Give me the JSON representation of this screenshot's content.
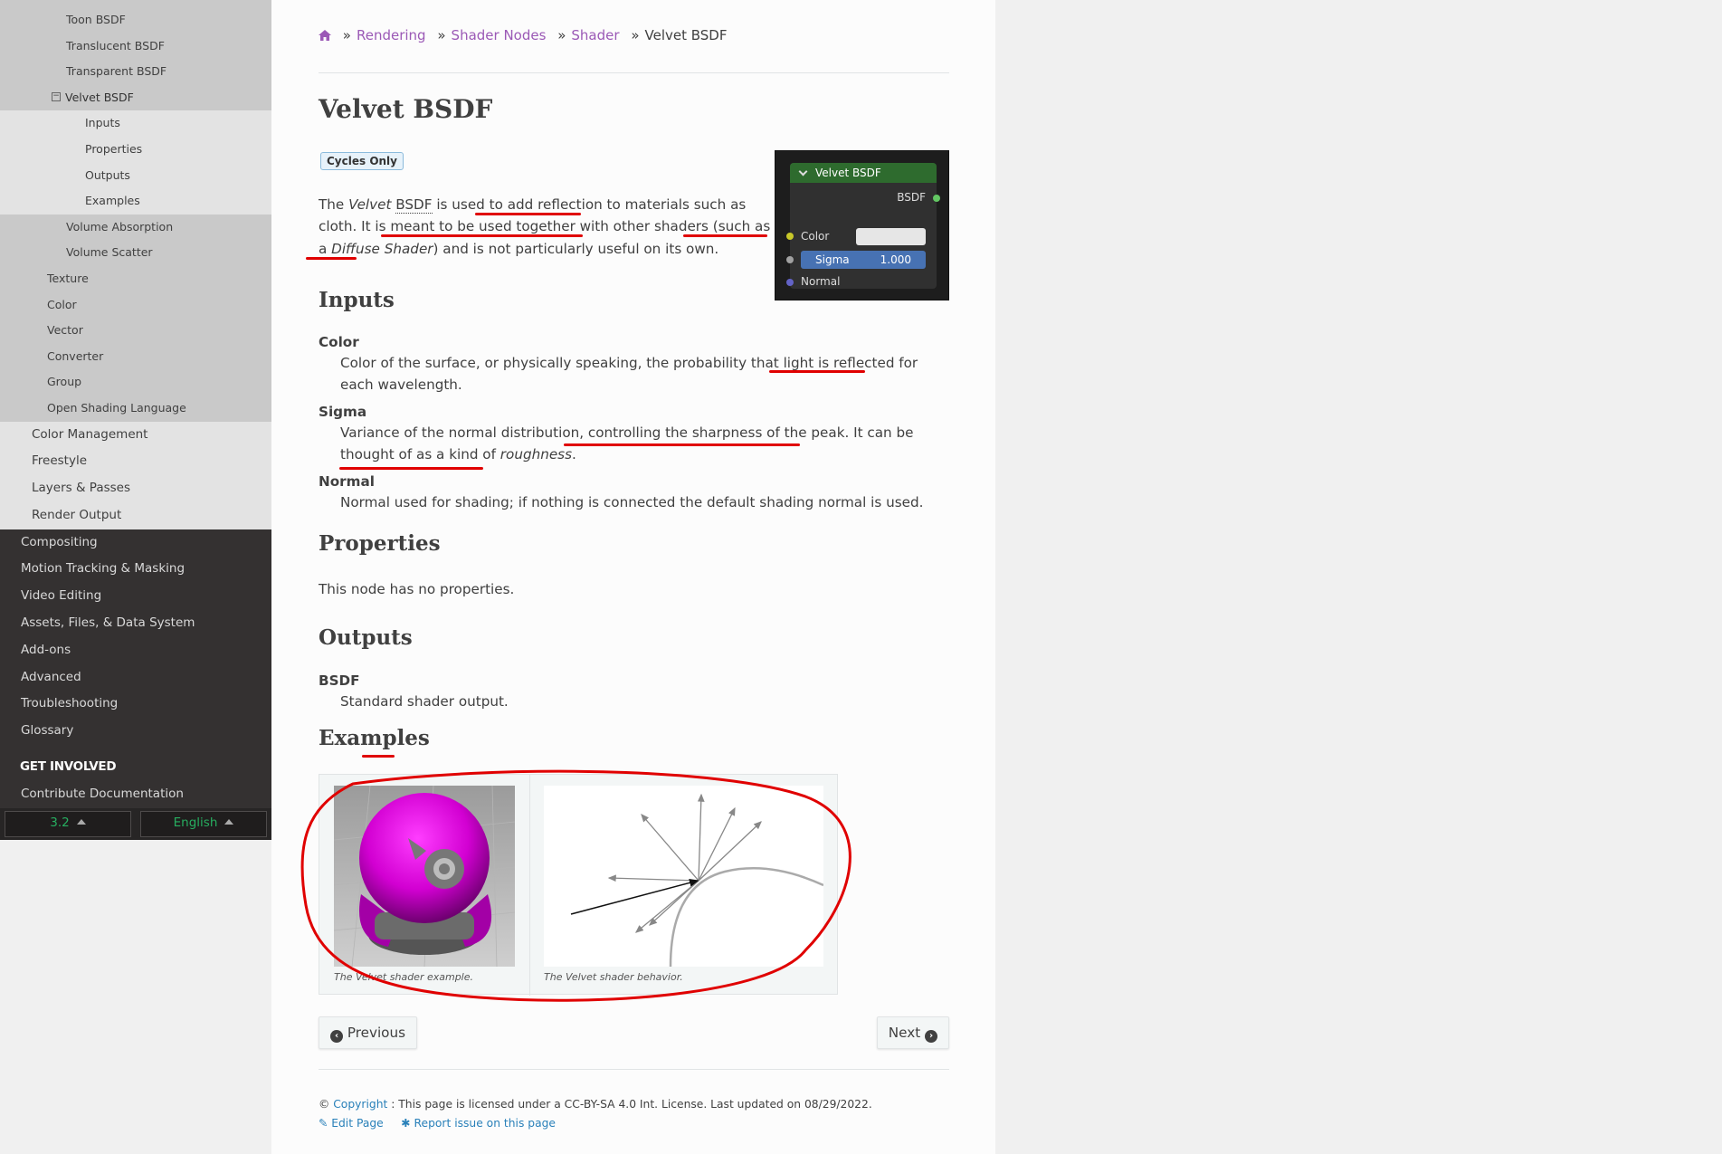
{
  "sidebar": {
    "items_l4a": [
      "Toon BSDF",
      "Translucent BSDF",
      "Transparent BSDF"
    ],
    "current": "Velvet BSDF",
    "items_l5": [
      "Inputs",
      "Properties",
      "Outputs",
      "Examples"
    ],
    "items_l4b": [
      "Volume Absorption",
      "Volume Scatter"
    ],
    "items_l3": [
      "Texture",
      "Color",
      "Vector",
      "Converter",
      "Group",
      "Open Shading Language"
    ],
    "items_l2": [
      "Color Management",
      "Freestyle",
      "Layers & Passes",
      "Render Output"
    ],
    "items_l1": [
      "Compositing",
      "Motion Tracking & Masking",
      "Video Editing",
      "Assets, Files, & Data System",
      "Add-ons",
      "Advanced",
      "Troubleshooting",
      "Glossary"
    ],
    "caption": "GET INVOLVED",
    "contribute": "Contribute Documentation",
    "version": "3.2",
    "language": "English"
  },
  "breadcrumbs": {
    "sep": "»",
    "items": [
      "Rendering",
      "Shader Nodes",
      "Shader"
    ],
    "current": "Velvet BSDF"
  },
  "page": {
    "title": "Velvet BSDF",
    "badge": "Cycles Only",
    "intro": {
      "t1": "The ",
      "velvet": "Velvet",
      "t2": " ",
      "bsdf": "BSDF",
      "t3": " is used to add reflection to materials such as cloth. It is meant to be used together with other shaders (such as a ",
      "diffuse": "Diffuse Shader",
      "t4": ") and is not particularly useful on its own."
    },
    "inputs_heading": "Inputs",
    "inputs": [
      {
        "term": "Color",
        "desc": "Color of the surface, or physically speaking, the probability that light is reflected for each wavelength."
      },
      {
        "term": "Sigma",
        "desc_a": "Variance of the normal distribution, controlling the sharpness of the peak. It can be thought of as a kind of ",
        "desc_em": "roughness",
        "desc_b": "."
      },
      {
        "term": "Normal",
        "desc": "Normal used for shading; if nothing is connected the default shading normal is used."
      }
    ],
    "properties_heading": "Properties",
    "properties_text": "This node has no properties.",
    "outputs_heading": "Outputs",
    "outputs": [
      {
        "term": "BSDF",
        "desc": "Standard shader output."
      }
    ],
    "examples_heading": "Examples",
    "fig1_caption": "The Velvet shader example.",
    "fig2_caption": "The Velvet shader behavior."
  },
  "node": {
    "title": "Velvet BSDF",
    "output": "BSDF",
    "color_label": "Color",
    "sigma_label": "Sigma",
    "sigma_value": "1.000",
    "normal_label": "Normal"
  },
  "nav": {
    "previous": "Previous",
    "next": "Next"
  },
  "footer": {
    "copyright_symbol": "©",
    "copyright_link": "Copyright",
    "license_text": ": This page is licensed under a CC-BY-SA 4.0 Int. License. Last updated on 08/29/2022.",
    "edit": "Edit Page",
    "report": "Report issue on this page"
  },
  "colors": {
    "link": "#9b59b6",
    "annotation": "#e00000",
    "version_green": "#27ae60"
  }
}
